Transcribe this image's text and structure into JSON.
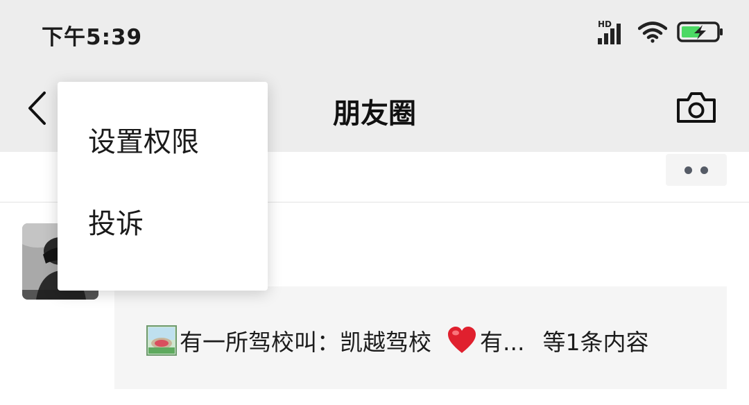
{
  "status_bar": {
    "time": "下午5:39",
    "network_label": "HD",
    "icons": [
      "signal-icon",
      "wifi-icon",
      "battery-charging-icon"
    ],
    "battery_color": "#4cd964"
  },
  "nav": {
    "title": "朋友圈",
    "back_icon": "chevron-left-icon",
    "camera_icon": "camera-icon"
  },
  "popup_menu": {
    "items": [
      {
        "label": "设置权限"
      },
      {
        "label": "投诉"
      }
    ]
  },
  "post": {
    "avatar_icon": "avatar",
    "more_icon": "more-dots-icon",
    "collapsed_summary": {
      "image_icon": "image-thumbnail-icon",
      "text": "有一所驾校叫：凯越驾校",
      "emoji_icon": "heart-icon",
      "truncated_text": "有...",
      "count_text": "等1条内容"
    }
  },
  "colors": {
    "header_bg": "#ededed",
    "card_bg": "#f5f5f5",
    "text": "#1a1a1a"
  }
}
